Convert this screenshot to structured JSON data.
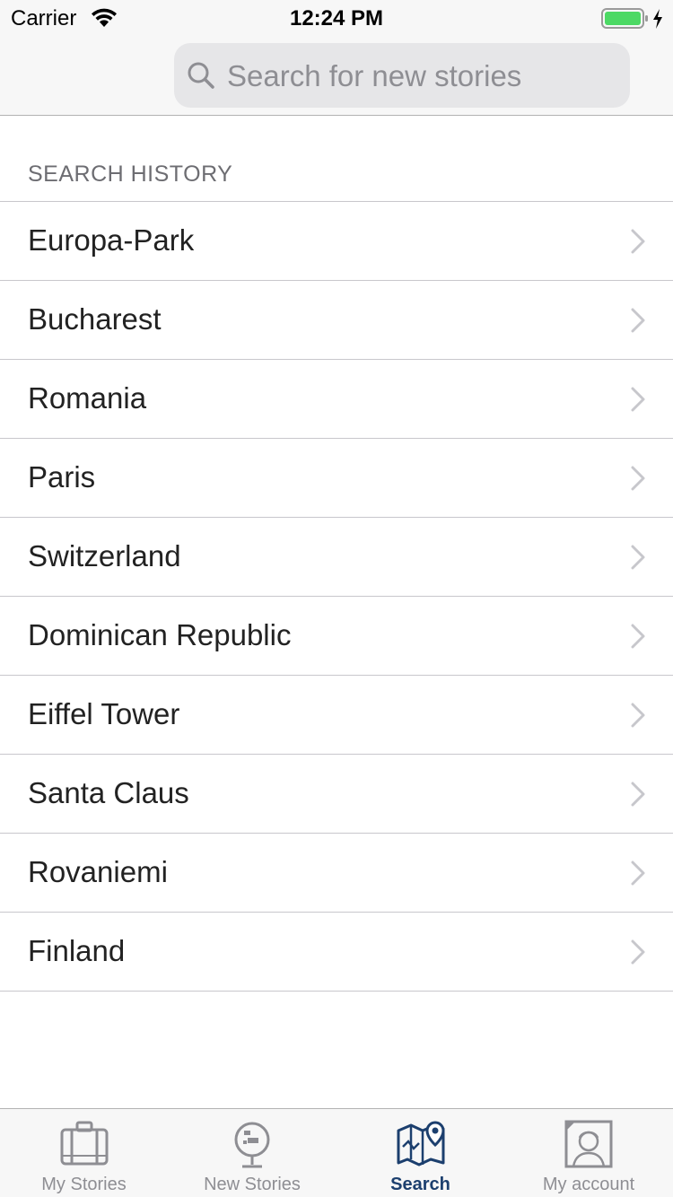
{
  "status_bar": {
    "carrier": "Carrier",
    "time": "12:24 PM",
    "battery_color": "#4cd964"
  },
  "search": {
    "placeholder": "Search for new stories"
  },
  "section": {
    "title": "SEARCH HISTORY"
  },
  "history": [
    {
      "label": "Europa-Park"
    },
    {
      "label": "Bucharest"
    },
    {
      "label": "Romania"
    },
    {
      "label": "Paris"
    },
    {
      "label": "Switzerland"
    },
    {
      "label": "Dominican Republic"
    },
    {
      "label": "Eiffel Tower"
    },
    {
      "label": "Santa Claus"
    },
    {
      "label": "Rovaniemi"
    },
    {
      "label": "Finland"
    }
  ],
  "tabs": [
    {
      "label": "My Stories",
      "icon": "suitcase-icon",
      "active": false
    },
    {
      "label": "New Stories",
      "icon": "globe-icon",
      "active": false
    },
    {
      "label": "Search",
      "icon": "map-pin-icon",
      "active": true
    },
    {
      "label": "My account",
      "icon": "user-photo-icon",
      "active": false
    }
  ],
  "colors": {
    "accent": "#1c3f6e",
    "inactive": "#8e8e93"
  }
}
